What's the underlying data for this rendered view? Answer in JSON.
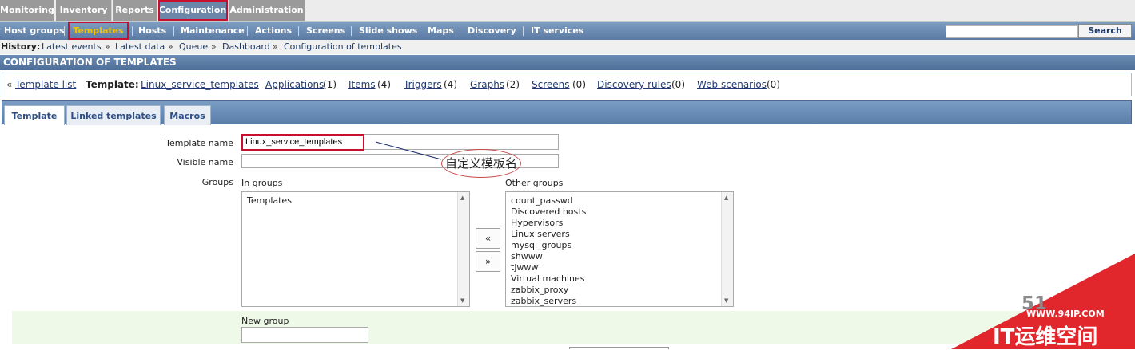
{
  "main_menu": [
    "Monitoring",
    "Inventory",
    "Reports",
    "Configuration",
    "Administration"
  ],
  "sub_menu": [
    "Host groups",
    "Templates",
    "Hosts",
    "Maintenance",
    "Actions",
    "Screens",
    "Slide shows",
    "Maps",
    "Discovery",
    "IT services"
  ],
  "search": {
    "value": "",
    "button": "Search"
  },
  "history": {
    "label": "History:",
    "items": [
      "Latest events",
      "Latest data",
      "Queue",
      "Dashboard",
      "Configuration of templates"
    ],
    "sep": "»"
  },
  "page_title": "CONFIGURATION OF TEMPLATES",
  "template_nav": {
    "back_arrow": "«",
    "template_list": "Template list",
    "template_label": "Template:",
    "template_name": "Linux_service_templates",
    "links": [
      {
        "label": "Applications",
        "count": "(1)"
      },
      {
        "label": "Items",
        "count": "(4)"
      },
      {
        "label": "Triggers",
        "count": "(4)"
      },
      {
        "label": "Graphs",
        "count": "(2)"
      },
      {
        "label": "Screens",
        "count": "(0)"
      },
      {
        "label": "Discovery rules",
        "count": "(0)"
      },
      {
        "label": "Web scenarios",
        "count": "(0)"
      }
    ]
  },
  "tabs": [
    "Template",
    "Linked templates",
    "Macros"
  ],
  "form": {
    "template_name_label": "Template name",
    "template_name_value": "Linux_service_templates",
    "visible_name_label": "Visible name",
    "visible_name_value": "",
    "groups_label": "Groups",
    "in_groups_label": "In groups",
    "other_groups_label": "Other groups",
    "in_groups": [
      "Templates"
    ],
    "other_groups": [
      "count_passwd",
      "Discovered hosts",
      "Hypervisors",
      "Linux servers",
      "mysql_groups",
      "shwww",
      "tjwww",
      "Virtual machines",
      "zabbix_proxy",
      "zabbix_servers"
    ],
    "move_left": "«",
    "move_right": "»",
    "new_group_label": "New group",
    "new_group_value": ""
  },
  "annotation": "自定义模板名",
  "watermark": {
    "site": "WWW.94IP.COM",
    "brand": "IT运维空间",
    "partial": "51"
  },
  "colors": {
    "highlight_red": "#c8102e",
    "menu_active": "#6b86a8",
    "submenu_active_text": "#f2c200"
  }
}
